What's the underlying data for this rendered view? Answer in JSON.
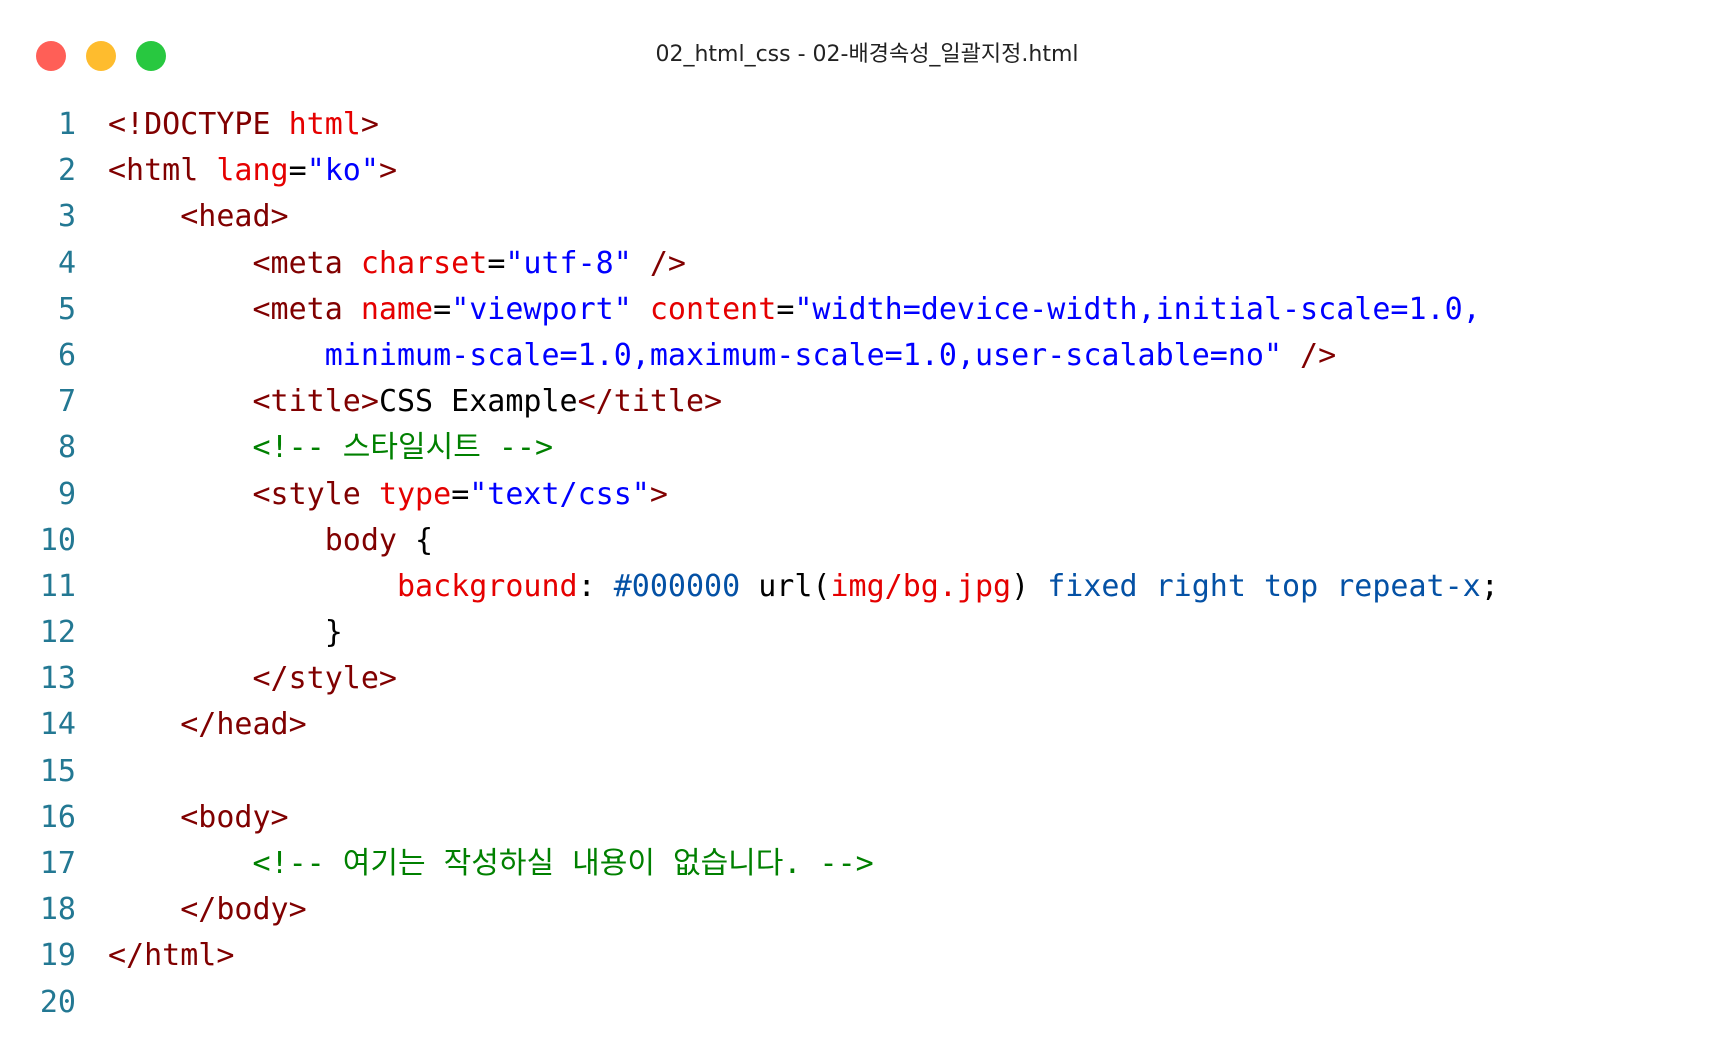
{
  "window": {
    "title": "02_html_css - 02-배경속성_일괄지정.html",
    "controls": {
      "close_color": "#ff5f57",
      "minimize_color": "#febc2e",
      "maximize_color": "#28c840"
    }
  },
  "editor": {
    "line_numbers": [
      "1",
      "2",
      "3",
      "4",
      "5",
      "6",
      "7",
      "8",
      "9",
      "10",
      "11",
      "12",
      "13",
      "14",
      "15",
      "16",
      "17",
      "18",
      "19",
      "20"
    ],
    "lines": [
      [
        {
          "t": "<!DOCTYPE ",
          "c": "tag"
        },
        {
          "t": "html",
          "c": "attr"
        },
        {
          "t": ">",
          "c": "tag"
        }
      ],
      [
        {
          "t": "<html ",
          "c": "tag"
        },
        {
          "t": "lang",
          "c": "attr"
        },
        {
          "t": "=",
          "c": "plain"
        },
        {
          "t": "\"ko\"",
          "c": "str"
        },
        {
          "t": ">",
          "c": "tag"
        }
      ],
      [
        {
          "t": "    <head>",
          "c": "tag"
        }
      ],
      [
        {
          "t": "        <meta ",
          "c": "tag"
        },
        {
          "t": "charset",
          "c": "attr"
        },
        {
          "t": "=",
          "c": "plain"
        },
        {
          "t": "\"utf-8\"",
          "c": "str"
        },
        {
          "t": " />",
          "c": "tag"
        }
      ],
      [
        {
          "t": "        <meta ",
          "c": "tag"
        },
        {
          "t": "name",
          "c": "attr"
        },
        {
          "t": "=",
          "c": "plain"
        },
        {
          "t": "\"viewport\"",
          "c": "str"
        },
        {
          "t": " ",
          "c": "plain"
        },
        {
          "t": "content",
          "c": "attr"
        },
        {
          "t": "=",
          "c": "plain"
        },
        {
          "t": "\"width=device-width,initial-scale=1.0,",
          "c": "str"
        }
      ],
      [
        {
          "t": "            minimum-scale=1.0,maximum-scale=1.0,user-scalable=no\"",
          "c": "str"
        },
        {
          "t": " />",
          "c": "tag"
        }
      ],
      [
        {
          "t": "        <title>",
          "c": "tag"
        },
        {
          "t": "CSS Example",
          "c": "plain"
        },
        {
          "t": "</title>",
          "c": "tag"
        }
      ],
      [
        {
          "t": "        <!-- 스타일시트 -->",
          "c": "cmt"
        }
      ],
      [
        {
          "t": "        <style ",
          "c": "tag"
        },
        {
          "t": "type",
          "c": "attr"
        },
        {
          "t": "=",
          "c": "plain"
        },
        {
          "t": "\"text/css\"",
          "c": "str"
        },
        {
          "t": ">",
          "c": "tag"
        }
      ],
      [
        {
          "t": "            body",
          "c": "tag"
        },
        {
          "t": " {",
          "c": "plain"
        }
      ],
      [
        {
          "t": "                ",
          "c": "plain"
        },
        {
          "t": "background",
          "c": "attr"
        },
        {
          "t": ": ",
          "c": "plain"
        },
        {
          "t": "#000000",
          "c": "num"
        },
        {
          "t": " url(",
          "c": "plain"
        },
        {
          "t": "img/bg.jpg",
          "c": "attr"
        },
        {
          "t": ") ",
          "c": "plain"
        },
        {
          "t": "fixed right top repeat-x",
          "c": "kw"
        },
        {
          "t": ";",
          "c": "plain"
        }
      ],
      [
        {
          "t": "            }",
          "c": "plain"
        }
      ],
      [
        {
          "t": "        </style>",
          "c": "tag"
        }
      ],
      [
        {
          "t": "    </head>",
          "c": "tag"
        }
      ],
      [],
      [
        {
          "t": "    <body>",
          "c": "tag"
        }
      ],
      [
        {
          "t": "        <!-- 여기는 작성하실 내용이 없습니다. -->",
          "c": "cmt"
        }
      ],
      [
        {
          "t": "    </body>",
          "c": "tag"
        }
      ],
      [
        {
          "t": "</html>",
          "c": "tag"
        }
      ],
      []
    ]
  }
}
